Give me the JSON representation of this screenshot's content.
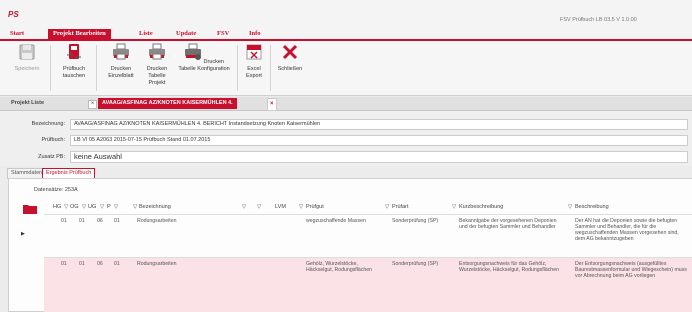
{
  "app": {
    "logo": "PS",
    "title": "FSV Prüfbuch LB 03.5 V 1.0.00"
  },
  "menu": [
    {
      "label": "Start",
      "active": false
    },
    {
      "label": "Projekt Bearbeiten",
      "active": true
    },
    {
      "label": "Liste",
      "active": false
    },
    {
      "label": "Update",
      "active": false
    },
    {
      "label": "FSV",
      "active": false
    },
    {
      "label": "Info",
      "active": false
    }
  ],
  "ribbon": [
    {
      "label": "Speichern",
      "icon": "save-icon",
      "disabled": true
    },
    {
      "label": "Prüfbuch tauschen",
      "icon": "swap-book-icon",
      "disabled": false
    },
    {
      "label": "Drucken Einzelblatt",
      "icon": "printer-icon",
      "disabled": false
    },
    {
      "label": "Drucken Tabelle Projekt",
      "icon": "printer-icon",
      "disabled": false
    },
    {
      "label": "Drucken Tabelle Konfiguration",
      "icon": "printer-gear-icon",
      "disabled": false
    },
    {
      "label": "Excel Export",
      "icon": "excel-icon",
      "disabled": false
    },
    {
      "label": "Schließen",
      "icon": "close-icon",
      "disabled": false
    }
  ],
  "project_bar": {
    "label": "Projekt Liste",
    "tab_title": "AVAAG/ASFINAG AZ/KNOTEN KAISERMÜHLEN 4."
  },
  "form": {
    "bezeichnung_label": "Bezeichnung:",
    "bezeichnung": "AVAAG/ASFINAG AZ/KNOTEN KAISERMÜHLEN 4. BERICHT Instandsetzung Knoten Kaisermühlen",
    "pruefbuch_label": "Prüfbuch:",
    "pruefbuch": "LB VI 05 A2063 2015-07-15 Prüfbuch Stand 01.07.2015",
    "zusatz_label": "Zusatz PB:",
    "zusatz": "keine Auswahl"
  },
  "subtabs": [
    {
      "label": "Stammdaten",
      "active": false
    },
    {
      "label": "Ergebnis Prüfbuch",
      "active": true
    }
  ],
  "grid": {
    "count": "Datensätze: 253A",
    "headers": [
      "HG",
      "OG",
      "UG",
      "P",
      "Bezeichnung",
      "LVM",
      "Prüfgut",
      "Prüfart",
      "Kurzbeschreibung",
      "Beschreibung"
    ],
    "rows": [
      {
        "hg": "01",
        "og": "01",
        "ug": "06",
        "p": "01",
        "bezeichnung": "Rodungsarbeiten",
        "pruefgut": "wegzuschaffende Massen",
        "pruefart": "Sonderprüfung (SP)",
        "kurz": "Bekanntgabe der vorgesehenen Deponien und der befugten Sammler und Behandler",
        "beschreibung": "Der AN hat die Deponien sowie die befugten Sammler und Behandler, die für die wegzuschaffenden Massen vorgesehen sind, dem AG bekanntzugeben",
        "highlight": false,
        "marker": "▶"
      },
      {
        "hg": "01",
        "og": "01",
        "ug": "06",
        "p": "01",
        "bezeichnung": "Rodungsarbeiten",
        "pruefgut": "Gehölz, Wurzelstöcke, Häckselgut, Rodungsflächen",
        "pruefart": "Sonderprüfung (SP)",
        "kurz": "Entsorgungsnachweis für das Gehölz, Wurzelstöcke, Häckselgut, Rodungsflächen",
        "beschreibung": "Der Entsorgungsnachweis (ausgefülltes Baurestmassenformular und Wiegeschein) muss vor Abrechnung beim AG vorliegen",
        "highlight": true,
        "marker": ""
      }
    ]
  },
  "colors": {
    "accent": "#c8102e",
    "highlight_row": "#fbe2e6"
  }
}
